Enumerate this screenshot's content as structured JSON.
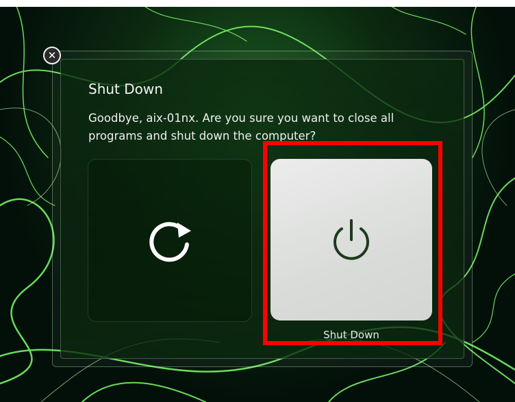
{
  "dialog": {
    "title": "Shut Down",
    "message": "Goodbye, aix-01nx. Are you sure you want to close all programs and shut down the computer?",
    "close_icon": "close-icon"
  },
  "options": {
    "restart": {
      "icon": "restart-icon"
    },
    "shutdown": {
      "icon": "power-icon",
      "label": "Shut Down"
    }
  },
  "colors": {
    "highlight": "#ff0000",
    "wallpaper_accent": "#4cff4c"
  }
}
